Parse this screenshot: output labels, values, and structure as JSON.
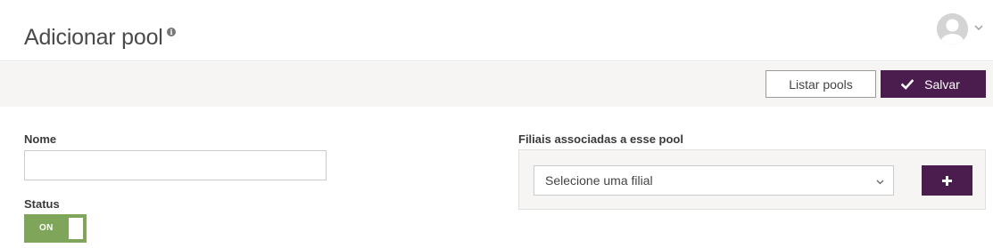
{
  "header": {
    "title": "Adicionar pool",
    "info_icon": "info-icon",
    "avatar_icon": "user-avatar-icon",
    "menu_icon": "chevron-down-icon"
  },
  "toolbar": {
    "list_label": "Listar pools",
    "save_label": "Salvar",
    "save_icon": "check-icon"
  },
  "form": {
    "name_label": "Nome",
    "name_value": "",
    "status_label": "Status",
    "status_toggle": "ON",
    "branches_label": "Filiais associadas a esse pool",
    "branch_select_value": "Selecione uma filial",
    "add_icon": "plus-icon"
  },
  "colors": {
    "brand": "#4b1d4e",
    "toggle_on": "#7fa55a",
    "toolbar_bg": "#f6f5f3"
  }
}
